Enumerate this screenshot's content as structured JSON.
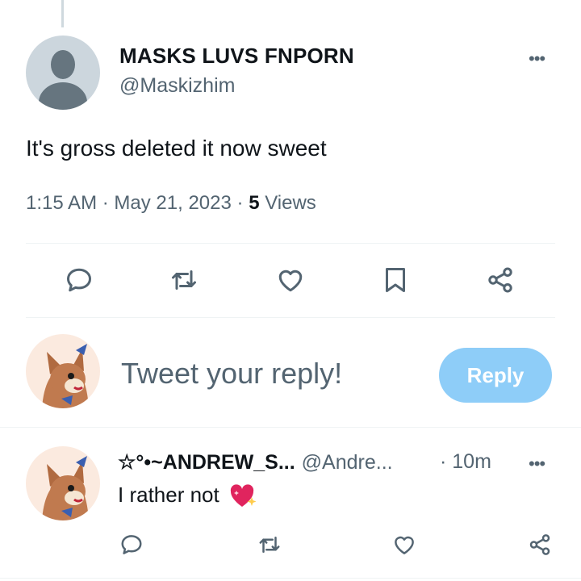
{
  "tweet": {
    "author_name": "MASKS LUVS FNPORN",
    "author_handle": "@Maskizhim",
    "text": "It's gross deleted it now sweet",
    "time": "1:15 AM",
    "date": "May 21, 2023",
    "views_count": "5",
    "views_label": "Views",
    "separator": "·",
    "more_menu": "•••"
  },
  "actions": [
    "reply-icon",
    "retweet-icon",
    "like-icon",
    "bookmark-icon",
    "share-icon"
  ],
  "composer": {
    "placeholder": "Tweet your reply!",
    "button_label": "Reply",
    "button_color": "#8ecdf8"
  },
  "reply": {
    "author_name": "☆°•~ANDREW_S...",
    "author_handle": "@Andre...",
    "time": "· 10m",
    "text": "I rather not",
    "more_menu": "•••",
    "emoji": "sparkling-heart"
  },
  "colors": {
    "text_primary": "#0f1419",
    "text_secondary": "#536471",
    "divider": "#eff3f4",
    "icon": "#536471"
  }
}
